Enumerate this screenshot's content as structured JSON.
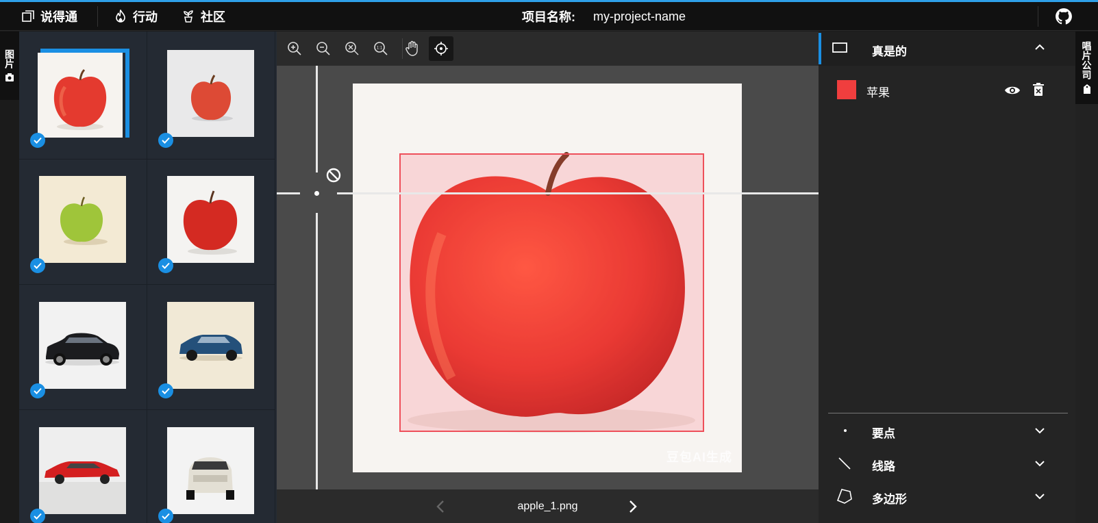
{
  "header": {
    "brand": "说得通",
    "nav_action": "行动",
    "nav_community": "社区",
    "project_label": "项目名称:",
    "project_name": "my-project-name"
  },
  "left_tab": {
    "label": "图片"
  },
  "right_tab": {
    "label": "唱片公司"
  },
  "thumbnails": [
    {
      "subject": "red apple",
      "selected": true,
      "checked": true
    },
    {
      "subject": "red apple small",
      "selected": false,
      "checked": true
    },
    {
      "subject": "green apple",
      "selected": false,
      "checked": true
    },
    {
      "subject": "red apple",
      "selected": false,
      "checked": true
    },
    {
      "subject": "black sedan",
      "selected": false,
      "checked": true
    },
    {
      "subject": "blue suv",
      "selected": false,
      "checked": true
    },
    {
      "subject": "red sedan",
      "selected": false,
      "checked": true
    },
    {
      "subject": "white car",
      "selected": false,
      "checked": true
    }
  ],
  "toolbar": {
    "tools": [
      "zoom-in-icon",
      "zoom-out-icon",
      "zoom-fit-icon",
      "zoom-actual-icon",
      "hand-icon",
      "crosshair-icon"
    ],
    "zoom_actual_text": "1:1",
    "active_tool": "crosshair-icon"
  },
  "canvas": {
    "watermark": "豆包AI生成",
    "box_color": "#ee4f5a"
  },
  "footer": {
    "filename": "apple_1.png"
  },
  "right_panel": {
    "section_title": "真是的",
    "label": {
      "name": "苹果",
      "color": "#f03e3e"
    },
    "tools": [
      {
        "name": "要点",
        "icon": "dot-icon"
      },
      {
        "name": "线路",
        "icon": "line-icon"
      },
      {
        "name": "多边形",
        "icon": "polygon-icon"
      }
    ]
  },
  "colors": {
    "accent": "#1a8fe3",
    "header_bg": "#111111",
    "panel_bg": "#242424"
  }
}
